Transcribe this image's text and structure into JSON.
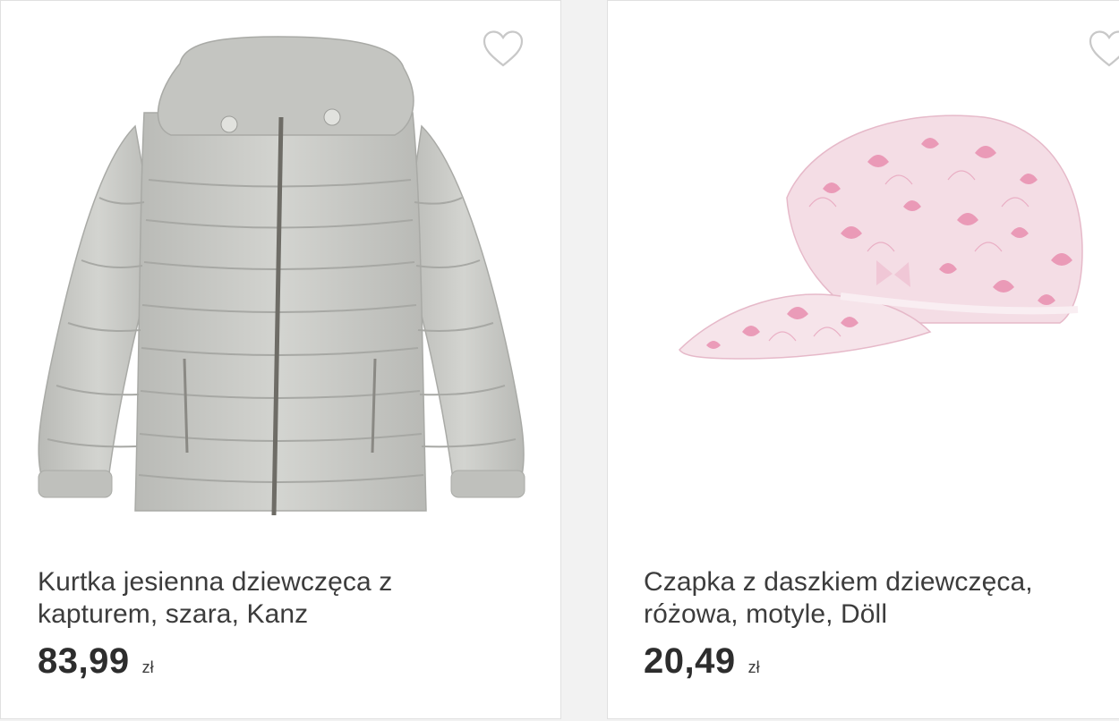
{
  "products": [
    {
      "title": "Kurtka jesienna dziewczęca z kapturem, szara, Kanz",
      "price": "83,99",
      "currency": "zł",
      "image": "grey-puffer-jacket-image",
      "favorite_icon": "heart-outline-icon"
    },
    {
      "title": "Czapka z daszkiem dziewczęca, różowa, motyle, Döll",
      "price": "20,49",
      "currency": "zł",
      "image": "pink-butterfly-cap-image",
      "favorite_icon": "heart-outline-icon"
    }
  ],
  "colors": {
    "text": "#3c3c3c",
    "price": "#2d2d2d",
    "icon": "#c8c8c8",
    "jacket": "#c9cac6",
    "cap": "#f4dbe3",
    "cap_print": "#e98fb0"
  }
}
